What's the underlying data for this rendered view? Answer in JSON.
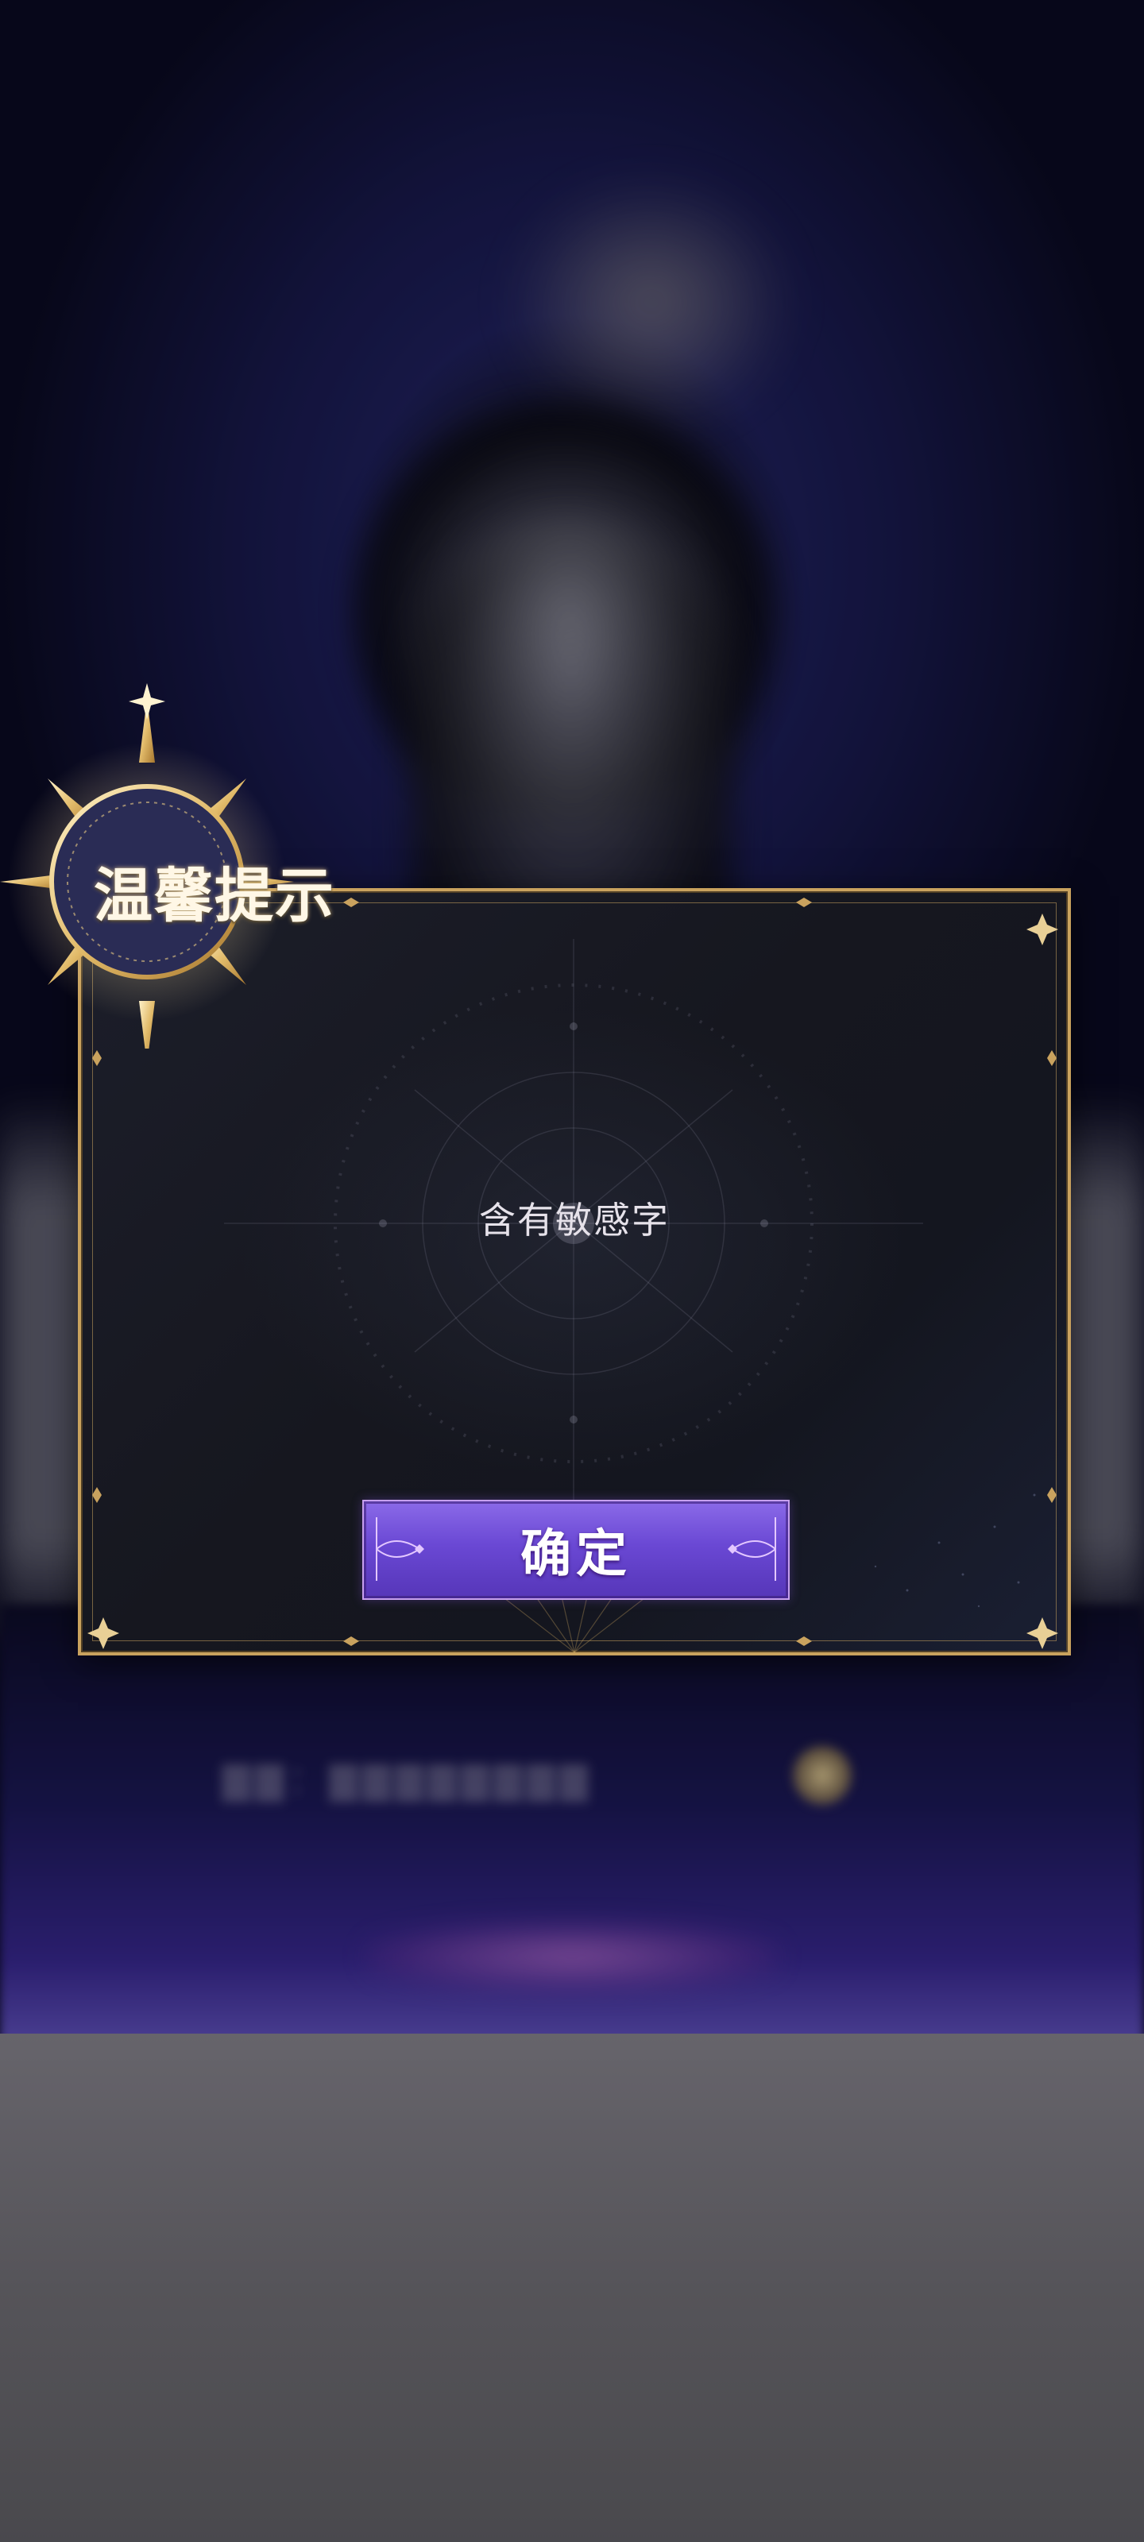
{
  "dialog": {
    "title": "温馨提示",
    "message": "含有敏感字",
    "confirm_label": "确定"
  },
  "colors": {
    "frame_gold": "#c9a25e",
    "button_purple": "#6a48d4",
    "dialog_bg": "#16171f"
  },
  "icons": {
    "title_emblem": "crescent-moon-sun-emblem-icon",
    "corner": "star-corner-icon"
  }
}
